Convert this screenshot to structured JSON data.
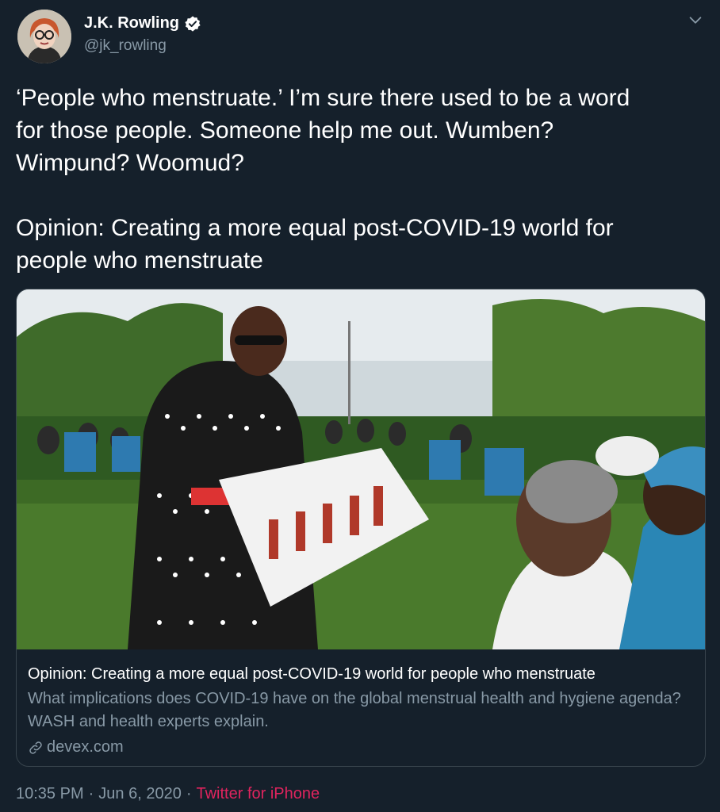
{
  "author": {
    "display_name": "J.K. Rowling",
    "handle": "@jk_rowling",
    "verified_icon": "verified-badge-icon"
  },
  "tweet": {
    "text": "‘People who menstruate.’ I’m sure there used to be a word\nfor those people. Someone help me out. Wumben?\nWimpund? Woomud?\n\nOpinion: Creating a more equal post-COVID-19 world for\npeople who menstruate"
  },
  "card": {
    "title": "Opinion: Creating a more equal post-COVID-19 world for people who menstruate",
    "description": "What implications does COVID-19 have on the global menstrual health and hygiene agenda? WASH and health experts explain.",
    "domain": "devex.com"
  },
  "meta": {
    "time": "10:35 PM",
    "separator": "·",
    "date": "Jun 6, 2020",
    "separator2": "·",
    "source": "Twitter for iPhone"
  },
  "colors": {
    "background": "#15202b",
    "secondary_text": "#8899a6",
    "source_link": "#e0245e",
    "border": "#38444d"
  }
}
